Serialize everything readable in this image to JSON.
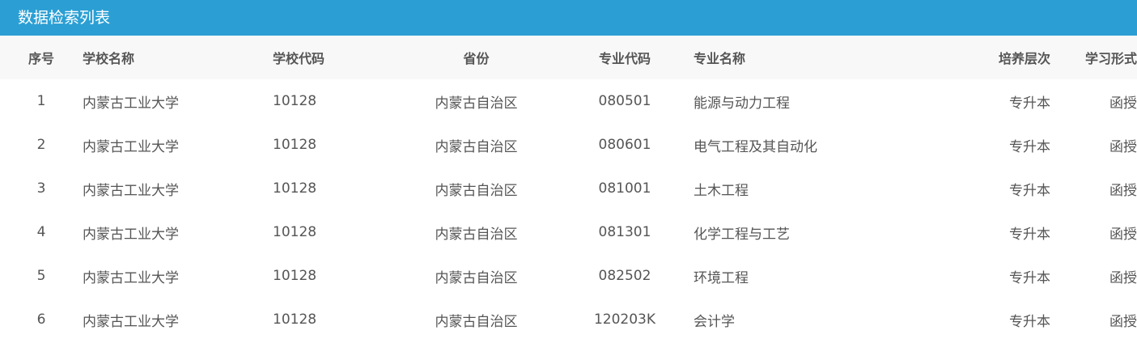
{
  "panel": {
    "title": "数据检索列表"
  },
  "table": {
    "headers": {
      "index": "序号",
      "school_name": "学校名称",
      "school_code": "学校代码",
      "province": "省份",
      "major_code": "专业代码",
      "major_name": "专业名称",
      "level": "培养层次",
      "study_form": "学习形式"
    },
    "rows": [
      {
        "index": "1",
        "school_name": "内蒙古工业大学",
        "school_code": "10128",
        "province": "内蒙古自治区",
        "major_code": "080501",
        "major_name": "能源与动力工程",
        "level": "专升本",
        "study_form": "函授"
      },
      {
        "index": "2",
        "school_name": "内蒙古工业大学",
        "school_code": "10128",
        "province": "内蒙古自治区",
        "major_code": "080601",
        "major_name": "电气工程及其自动化",
        "level": "专升本",
        "study_form": "函授"
      },
      {
        "index": "3",
        "school_name": "内蒙古工业大学",
        "school_code": "10128",
        "province": "内蒙古自治区",
        "major_code": "081001",
        "major_name": "土木工程",
        "level": "专升本",
        "study_form": "函授"
      },
      {
        "index": "4",
        "school_name": "内蒙古工业大学",
        "school_code": "10128",
        "province": "内蒙古自治区",
        "major_code": "081301",
        "major_name": "化学工程与工艺",
        "level": "专升本",
        "study_form": "函授"
      },
      {
        "index": "5",
        "school_name": "内蒙古工业大学",
        "school_code": "10128",
        "province": "内蒙古自治区",
        "major_code": "082502",
        "major_name": "环境工程",
        "level": "专升本",
        "study_form": "函授"
      },
      {
        "index": "6",
        "school_name": "内蒙古工业大学",
        "school_code": "10128",
        "province": "内蒙古自治区",
        "major_code": "120203K",
        "major_name": "会计学",
        "level": "专升本",
        "study_form": "函授"
      }
    ]
  },
  "colors": {
    "header_bar": "#2b9fd4",
    "column_header_bg": "#f8f8f8",
    "text": "#555555"
  }
}
